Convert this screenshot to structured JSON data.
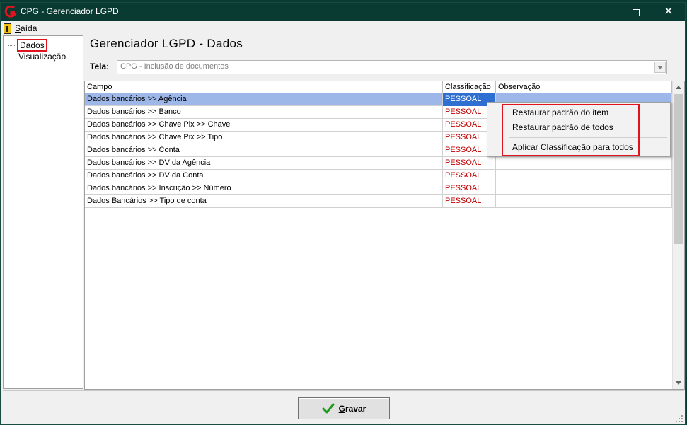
{
  "window": {
    "title": "CPG - Gerenciador LGPD",
    "minimize_glyph": "—",
    "close_glyph": "✕"
  },
  "menu": {
    "exit_label": "Saída",
    "exit_icon": "exit-door-icon"
  },
  "tree": {
    "items": [
      {
        "label": "Dados",
        "selected": true
      },
      {
        "label": "Visualização",
        "selected": false
      }
    ]
  },
  "main": {
    "title": "Gerenciador LGPD - Dados",
    "tela_label": "Tela:",
    "tela_value": "CPG - Inclusão de documentos"
  },
  "grid": {
    "columns": [
      "Campo",
      "Classificação",
      "Observação"
    ],
    "rows": [
      {
        "campo": "Dados bancários >> Agência",
        "classificacao": "PESSOAL",
        "observacao": ""
      },
      {
        "campo": "Dados bancários >> Banco",
        "classificacao": "PESSOAL",
        "observacao": ""
      },
      {
        "campo": "Dados bancários >> Chave Pix >> Chave",
        "classificacao": "PESSOAL",
        "observacao": ""
      },
      {
        "campo": "Dados bancários >> Chave Pix >> Tipo",
        "classificacao": "PESSOAL",
        "observacao": ""
      },
      {
        "campo": "Dados bancários >> Conta",
        "classificacao": "PESSOAL",
        "observacao": ""
      },
      {
        "campo": "Dados bancários >> DV da Agência",
        "classificacao": "PESSOAL",
        "observacao": ""
      },
      {
        "campo": "Dados bancários >> DV da Conta",
        "classificacao": "PESSOAL",
        "observacao": ""
      },
      {
        "campo": "Dados bancários >> Inscrição >> Número",
        "classificacao": "PESSOAL",
        "observacao": ""
      },
      {
        "campo": "Dados Bancários >> Tipo de conta",
        "classificacao": "PESSOAL",
        "observacao": ""
      }
    ]
  },
  "context_menu": {
    "items": [
      "Restaurar padrão do item",
      "Restaurar padrão de todos",
      "Aplicar Classificação para todos"
    ]
  },
  "footer": {
    "save_label": "Gravar"
  },
  "colors": {
    "titlebar": "#0a3b33",
    "classification_text": "#c00000",
    "selected_row": "#9db8e8",
    "selected_cell": "#2f6fd1",
    "highlight_outline": "#e0141e",
    "check_icon": "#1e9a1e"
  }
}
